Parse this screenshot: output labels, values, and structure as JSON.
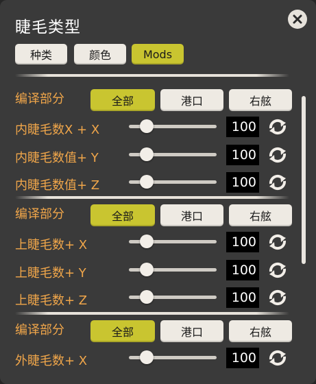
{
  "title": "睫毛类型",
  "icons": {
    "close": "close-x-circle-icon",
    "reset": "reset-arrows-icon"
  },
  "colors": {
    "accent": "#c9c530",
    "label": "#f0a64a",
    "panel": "#3a3a3a"
  },
  "tabs": [
    {
      "label": "种类",
      "active": false
    },
    {
      "label": "颜色",
      "active": false
    },
    {
      "label": "Mods",
      "active": true
    }
  ],
  "sections": [
    {
      "label": "编译部分",
      "options": [
        {
          "label": "全部",
          "active": true
        },
        {
          "label": "港口",
          "active": false
        },
        {
          "label": "右舷",
          "active": false
        }
      ],
      "sliders": [
        {
          "label": "内睫毛数X + X",
          "value": "100",
          "level": 0.2
        },
        {
          "label": "内睫毛数值+ Y",
          "value": "100",
          "level": 0.2
        },
        {
          "label": "内睫毛数值+ Z",
          "value": "100",
          "level": 0.2
        }
      ]
    },
    {
      "label": "编译部分",
      "options": [
        {
          "label": "全部",
          "active": true
        },
        {
          "label": "港口",
          "active": false
        },
        {
          "label": "右舷",
          "active": false
        }
      ],
      "sliders": [
        {
          "label": "上睫毛数+ X",
          "value": "100",
          "level": 0.2
        },
        {
          "label": "上睫毛数+ Y",
          "value": "100",
          "level": 0.2
        },
        {
          "label": "上睫毛数+ Z",
          "value": "100",
          "level": 0.2
        }
      ]
    },
    {
      "label": "编译部分",
      "options": [
        {
          "label": "全部",
          "active": true
        },
        {
          "label": "港口",
          "active": false
        },
        {
          "label": "右舷",
          "active": false
        }
      ],
      "sliders": [
        {
          "label": "外睫毛数+ X",
          "value": "100",
          "level": 0.2
        }
      ]
    }
  ]
}
